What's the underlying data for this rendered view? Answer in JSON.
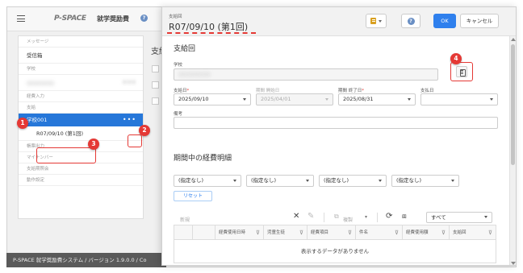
{
  "header": {
    "app_title": "就学奨励費",
    "logo": "P-SPACE"
  },
  "sidebar": {
    "message_section": "メッセージ",
    "inbox": "受信箱",
    "school_section": "学校",
    "school_blurred": "○○○○○○",
    "expense_input": "経費入力",
    "payment_section": "支給",
    "selected_school": "学校001",
    "payment_round_item": "R07/09/10 (第1回)",
    "tax_output": "帳票出力",
    "my_number": "マイナンバー",
    "payment_inquiry": "支給期照会",
    "settings": "動作設定"
  },
  "background": {
    "main_title": "支給"
  },
  "footer": {
    "text": "P-SPACE 就学奨励費システム / バージョン 1.9.0.0 / Co"
  },
  "modal": {
    "label": "支給回",
    "title": "R07/09/10 (第1回)",
    "ok_label": "OK",
    "cancel_label": "キャンセル",
    "section1_title": "支給回",
    "school_label": "学校",
    "school_value": "○○○○○○○",
    "payment_date_label": "支給日",
    "payment_date_value": "2025/09/10",
    "period_start_label": "期間 開始日",
    "period_start_value": "2025/04/01",
    "period_end_label": "期間 終了日",
    "period_end_value": "2025/08/31",
    "pay_date_label": "支払日",
    "pay_date_value": "",
    "note_label": "備考",
    "section2_title": "期間中の経費明細",
    "filter_options": [
      "(指定なし)",
      "(指定なし)",
      "(指定なし)",
      "(指定なし)"
    ],
    "reset_label": "リセット",
    "new_label": "新規",
    "copy_label": "複製",
    "view_select": "すべて",
    "columns": [
      "経費使用日時",
      "児童生徒",
      "経費項目",
      "件名",
      "経費使用額",
      "支給回"
    ],
    "empty_message": "表示するデータがありません"
  },
  "callouts": [
    "1",
    "2",
    "3",
    "4"
  ],
  "colors": {
    "accent": "#2f80ed",
    "selected": "#2677d9",
    "callout": "#e53935"
  }
}
